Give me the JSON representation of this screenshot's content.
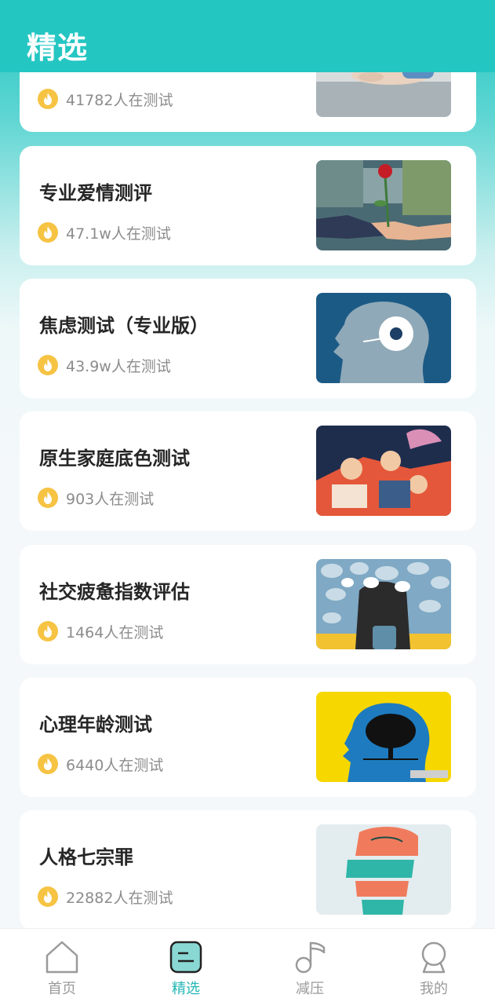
{
  "header": {
    "title": "精选"
  },
  "cards": [
    {
      "title": "",
      "count": "41782人在测试",
      "image": "feet-on-floor-photo"
    },
    {
      "title": "专业爱情测评",
      "count": "47.1w人在测试",
      "image": "rose-handover-photo"
    },
    {
      "title": "焦虑测试（专业版）",
      "count": "43.9w人在测试",
      "image": "daisy-head-illustration"
    },
    {
      "title": "原生家庭底色测试",
      "count": "903人在测试",
      "image": "family-illustration"
    },
    {
      "title": "社交疲惫指数评估",
      "count": "1464人在测试",
      "image": "speech-bubbles-illustration"
    },
    {
      "title": "心理年龄测试",
      "count": "6440人在测试",
      "image": "tree-head-illustration"
    },
    {
      "title": "人格七宗罪",
      "count": "22882人在测试",
      "image": "sliced-statue-illustration"
    }
  ],
  "tabs": [
    {
      "label": "首页",
      "icon": "home-icon",
      "active": false
    },
    {
      "label": "精选",
      "icon": "featured-icon",
      "active": true
    },
    {
      "label": "减压",
      "icon": "music-note-icon",
      "active": false
    },
    {
      "label": "我的",
      "icon": "profile-icon",
      "active": false
    }
  ],
  "colors": {
    "accent": "#24c6c2",
    "fire": "#f6c343",
    "title_text": "#262626",
    "meta_text": "#8c8c8c"
  }
}
